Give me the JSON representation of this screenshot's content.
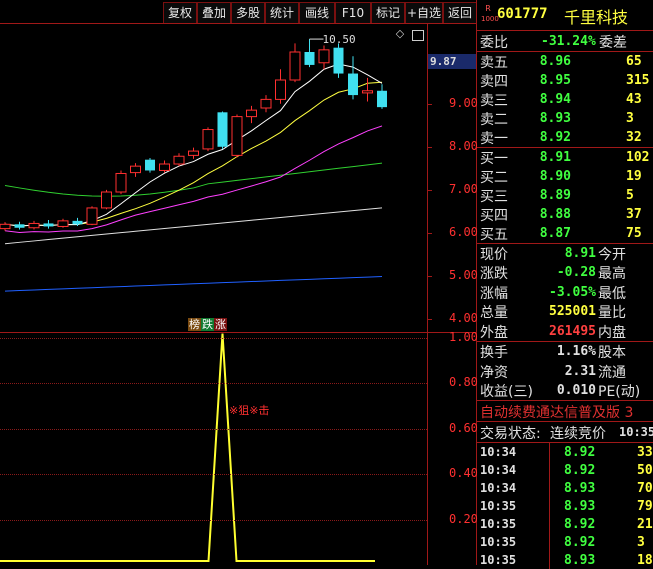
{
  "toolbar": {
    "buttons": [
      "复权",
      "叠加",
      "多股",
      "统计",
      "画线",
      "F10",
      "标记",
      "+自选",
      "返回"
    ],
    "diamond_icon": "diamond-icon",
    "grid_icon": "grid-icon"
  },
  "stock": {
    "badge_top": "R",
    "badge_bottom": "1000",
    "code": "601777",
    "name": "千里科技"
  },
  "weibi": {
    "label": "委比",
    "value": "-31.24%",
    "label2": "委差"
  },
  "sell_orders": [
    {
      "label": "卖五",
      "price": "8.96",
      "vol": "65"
    },
    {
      "label": "卖四",
      "price": "8.95",
      "vol": "315"
    },
    {
      "label": "卖三",
      "price": "8.94",
      "vol": "43"
    },
    {
      "label": "卖二",
      "price": "8.93",
      "vol": "3"
    },
    {
      "label": "卖一",
      "price": "8.92",
      "vol": "32"
    }
  ],
  "buy_orders": [
    {
      "label": "买一",
      "price": "8.91",
      "vol": "102"
    },
    {
      "label": "买二",
      "price": "8.90",
      "vol": "19"
    },
    {
      "label": "买三",
      "price": "8.89",
      "vol": "5"
    },
    {
      "label": "买四",
      "price": "8.88",
      "vol": "37"
    },
    {
      "label": "买五",
      "price": "8.87",
      "vol": "75"
    }
  ],
  "quote": [
    {
      "label": "现价",
      "value": "8.91",
      "label2": "今开"
    },
    {
      "label": "涨跌",
      "value": "-0.28",
      "label2": "最高"
    },
    {
      "label": "涨幅",
      "value": "-3.05%",
      "label2": "最低"
    },
    {
      "label": "总量",
      "value": "525001",
      "label2": "量比"
    },
    {
      "label": "外盘",
      "value": "261495",
      "label2": "内盘"
    }
  ],
  "fin": [
    {
      "label": "换手",
      "value": "1.16%",
      "label2": "股本"
    },
    {
      "label": "净资",
      "value": "2.31",
      "label2": "流通"
    },
    {
      "label": "收益(三)",
      "value": "0.010",
      "label2": "PE(动)"
    }
  ],
  "marquee": "自动续费通达信普及版 3",
  "trade_status": {
    "label": "交易状态:",
    "value": "连续竞价",
    "time": "10:35"
  },
  "ticks": [
    {
      "time": "10:34",
      "price": "8.92",
      "vol": "33"
    },
    {
      "time": "10:34",
      "price": "8.92",
      "vol": "50"
    },
    {
      "time": "10:34",
      "price": "8.93",
      "vol": "70"
    },
    {
      "time": "10:35",
      "price": "8.93",
      "vol": "79"
    },
    {
      "time": "10:35",
      "price": "8.92",
      "vol": "21"
    },
    {
      "time": "10:35",
      "price": "8.92",
      "vol": "3"
    },
    {
      "time": "10:35",
      "price": "8.93",
      "vol": "18"
    }
  ],
  "main_chart": {
    "current_price_tag": "9.87",
    "high_marker": "10.50",
    "y_ticks": [
      "9.00",
      "8.00",
      "7.00",
      "6.00",
      "5.00",
      "4.00"
    ],
    "y_range": [
      3.7,
      10.85
    ],
    "indicator_tags": [
      "榜",
      "跌",
      "涨"
    ],
    "colors": {
      "up": "#ff3030",
      "down": "#40e0f0",
      "ma5": "#ffffff",
      "ma10": "#ffff40",
      "ma20": "#ff40ff",
      "ma60": "#30d030",
      "ma120": "#e0e0e0",
      "ma250": "#2060ff"
    }
  },
  "sub_chart": {
    "y_ticks": [
      "1.00",
      "0.80",
      "0.60",
      "0.40",
      "0.20"
    ],
    "y_range": [
      0,
      1.02
    ],
    "annotation": "※狙※击",
    "line_color": "#ffff30"
  },
  "chart_data": {
    "type": "candlestick",
    "candles": [
      {
        "o": 6.1,
        "c": 6.2,
        "h": 6.25,
        "l": 6.05
      },
      {
        "o": 6.2,
        "c": 6.12,
        "h": 6.26,
        "l": 6.08
      },
      {
        "o": 6.12,
        "c": 6.22,
        "h": 6.28,
        "l": 6.08
      },
      {
        "o": 6.22,
        "c": 6.15,
        "h": 6.3,
        "l": 6.1
      },
      {
        "o": 6.15,
        "c": 6.28,
        "h": 6.33,
        "l": 6.12
      },
      {
        "o": 6.28,
        "c": 6.2,
        "h": 6.35,
        "l": 6.16
      },
      {
        "o": 6.2,
        "c": 6.58,
        "h": 6.62,
        "l": 6.18
      },
      {
        "o": 6.58,
        "c": 6.95,
        "h": 7.0,
        "l": 6.55
      },
      {
        "o": 6.95,
        "c": 7.38,
        "h": 7.45,
        "l": 6.9
      },
      {
        "o": 7.4,
        "c": 7.55,
        "h": 7.62,
        "l": 7.3
      },
      {
        "o": 7.7,
        "c": 7.45,
        "h": 7.74,
        "l": 7.4
      },
      {
        "o": 7.45,
        "c": 7.6,
        "h": 7.68,
        "l": 7.4
      },
      {
        "o": 7.6,
        "c": 7.78,
        "h": 7.85,
        "l": 7.55
      },
      {
        "o": 7.8,
        "c": 7.9,
        "h": 7.98,
        "l": 7.72
      },
      {
        "o": 7.95,
        "c": 8.4,
        "h": 8.45,
        "l": 7.9
      },
      {
        "o": 8.8,
        "c": 8.0,
        "h": 8.82,
        "l": 7.95
      },
      {
        "o": 7.8,
        "c": 8.7,
        "h": 8.75,
        "l": 7.75
      },
      {
        "o": 8.7,
        "c": 8.85,
        "h": 8.95,
        "l": 8.55
      },
      {
        "o": 8.9,
        "c": 9.1,
        "h": 9.2,
        "l": 8.8
      },
      {
        "o": 9.1,
        "c": 9.55,
        "h": 9.8,
        "l": 9.0
      },
      {
        "o": 9.55,
        "c": 10.2,
        "h": 10.4,
        "l": 9.5
      },
      {
        "o": 10.2,
        "c": 9.9,
        "h": 10.5,
        "l": 9.85
      },
      {
        "o": 9.95,
        "c": 10.25,
        "h": 10.35,
        "l": 9.8
      },
      {
        "o": 10.3,
        "c": 9.7,
        "h": 10.4,
        "l": 9.6
      },
      {
        "o": 9.7,
        "c": 9.2,
        "h": 10.1,
        "l": 9.1
      },
      {
        "o": 9.25,
        "c": 9.3,
        "h": 9.6,
        "l": 9.05
      },
      {
        "o": 9.3,
        "c": 8.92,
        "h": 9.45,
        "l": 8.88
      }
    ]
  }
}
